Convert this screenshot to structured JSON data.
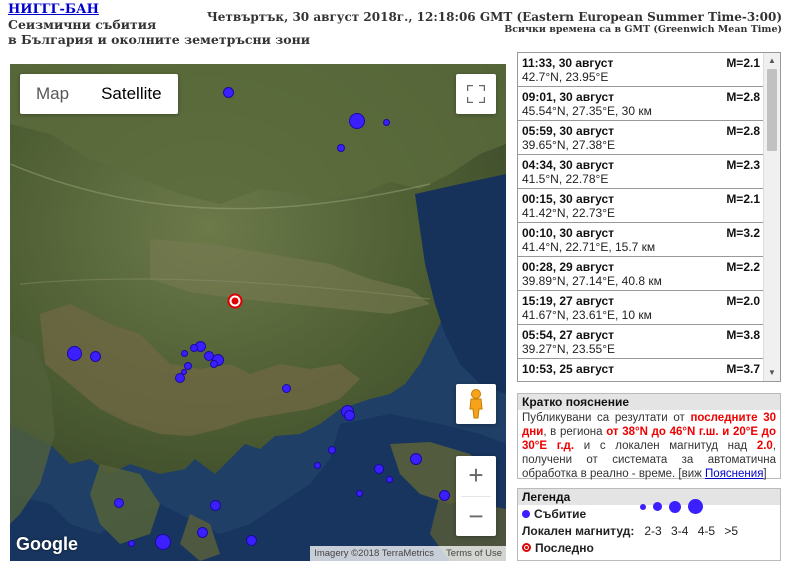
{
  "header": {
    "brand": "НИГГГ-БАН",
    "subtitle_line1": "Сеизмични събития",
    "subtitle_line2": "в България и околните земетръсни зони",
    "datetime": "Четвъртък, 30 август 2018г., 12:18:06 GMT (Eastern European Summer Time-3:00)",
    "gmt_note": "Всички времена са в GMT (Greenwich Mean Time)"
  },
  "map": {
    "type_map": "Map",
    "type_satellite": "Satellite",
    "logo": "Google",
    "imagery": "Imagery ©2018 TerraMetrics",
    "terms": "Terms of Use",
    "zoom_in": "+",
    "zoom_out": "−",
    "icons": {
      "fullscreen": "fullscreen-icon",
      "pegman": "pegman-icon",
      "last": "last-event-marker-icon"
    }
  },
  "events": [
    {
      "time": "11:33, 30 август",
      "mag": "M=2.1",
      "coords": "42.7°N, 23.95°E"
    },
    {
      "time": "09:01, 30 август",
      "mag": "M=2.8",
      "coords": "45.54°N, 27.35°E, 30 км"
    },
    {
      "time": "05:59, 30 август",
      "mag": "M=2.8",
      "coords": "39.65°N, 27.38°E"
    },
    {
      "time": "04:34, 30 август",
      "mag": "M=2.3",
      "coords": "41.5°N, 22.78°E"
    },
    {
      "time": "00:15, 30 август",
      "mag": "M=2.1",
      "coords": "41.42°N, 22.73°E"
    },
    {
      "time": "00:10, 30 август",
      "mag": "M=3.2",
      "coords": "41.4°N, 22.71°E, 15.7 км"
    },
    {
      "time": "00:28, 29 август",
      "mag": "M=2.2",
      "coords": "39.89°N, 27.14°E, 40.8 км"
    },
    {
      "time": "15:19, 27 август",
      "mag": "M=2.0",
      "coords": "41.67°N, 23.61°E, 10 км"
    },
    {
      "time": "05:54, 27 август",
      "mag": "M=3.8",
      "coords": "39.27°N, 23.55°E"
    },
    {
      "time": "10:53, 25 август",
      "mag": "M=3.7",
      "coords": ""
    }
  ],
  "explain": {
    "title": "Кратко пояснение",
    "p1": "Публикувани са резултати от",
    "r1": "последните 30 дни",
    "p2": ", в региона",
    "r2": "от 38°N до 46°N г.ш. и 20°E до 30°E г.д.",
    "p3": "и с локален магнитуд над",
    "r3": "2.0",
    "p4": ", получени от системата за автоматична обработка в реално - време. [виж",
    "link": "Пояснения",
    "p5": "]"
  },
  "legend": {
    "title": "Легенда",
    "event_label": "Събитие",
    "magnitude_label": "Локален магнитуд:",
    "ranges": "2-3 3-4 4-5 >5",
    "last_label": "Последно"
  },
  "colors": {
    "event": "#3b1fff",
    "last": "#dd0000",
    "link": "#0000cc",
    "highlight": "#ee0000"
  }
}
